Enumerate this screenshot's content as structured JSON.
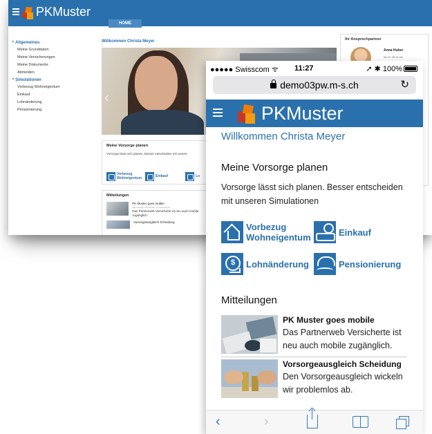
{
  "desktop": {
    "brand": "PKMuster",
    "nav_tab": "HOME",
    "sidebar": {
      "sections": [
        {
          "label": "Allgemeines",
          "items": [
            "Meine Grunddaten",
            "Meine Versicherungen",
            "Meine Dokumente",
            "Abmelden"
          ]
        },
        {
          "label": "Simulationen",
          "items": [
            "Vorbezug Wohneigentum",
            "Einkauf",
            "Lohnänderung",
            "Pensionierung"
          ]
        }
      ]
    },
    "welcome": "Willkommen Christa Meyer",
    "vorsorge": {
      "title": "Meine Vorsorge planen",
      "text": "Vorsorge lässt sich planen. Besser entscheiden mit unsere",
      "links": [
        "Vorbezug Wohneigentum",
        "Einkauf",
        "Lo"
      ]
    },
    "mitteilungen": {
      "title": "Mitteilungen",
      "items": [
        {
          "title": "PK Muster goes mobile",
          "meta": "Allgemeines | 20.06.2017 | Christa Meyer",
          "text": "Das Partnerweb Versicherte ist neu auch mobile zugänglich."
        },
        {
          "title": "Vorsorgeausgleich Scheidung",
          "meta": "",
          "text": ""
        }
      ]
    },
    "contact": {
      "title": "Ihr Ansprechpartner",
      "name": "Anna Huber",
      "hours": "Mo-Fr 09:00 bis"
    }
  },
  "phone": {
    "status": {
      "carrier": "●●●●● Swisscom ᯤ",
      "time": "11:27",
      "battery": "➚ ✱ 100%"
    },
    "url": "demo03pw.m-s.ch",
    "reload_icon": "↻",
    "brand": "PKMuster",
    "welcome": "Willkommen Christa Meyer",
    "vorsorge": {
      "title": "Meine Vorsorge planen",
      "text": "Vorsorge lässt sich planen. Besser entscheiden mit unseren Simulationen",
      "links": [
        {
          "label_line1": "Vorbezug",
          "label_line2": "Wohneigentum",
          "icon": "house-icon"
        },
        {
          "label_line1": "Einkauf",
          "label_line2": "",
          "icon": "hand-coin-icon"
        },
        {
          "label_line1": "Lohnänderung",
          "label_line2": "",
          "icon": "money-icon"
        },
        {
          "label_line1": "Pensionierung",
          "label_line2": "",
          "icon": "beach-icon"
        }
      ]
    },
    "mitteilungen": {
      "title": "Mitteilungen",
      "items": [
        {
          "title": "PK Muster goes mobile",
          "text": "Das Partnerweb Versicherte ist neu auch mobile zugänglich."
        },
        {
          "title": "Vorsorgeausgleich Scheidung",
          "text": "Den Vorsorgeausgleich wickeln wir problemlos ab."
        }
      ]
    },
    "toolbar": {
      "back": "‹",
      "forward": "›"
    }
  },
  "colors": {
    "brand_blue": "#2a70ad",
    "ios_blue": "#2f79c6",
    "logo_orange": "#f07d00",
    "logo_red": "#c0392b"
  }
}
